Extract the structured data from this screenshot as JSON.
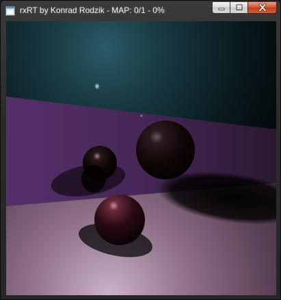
{
  "window": {
    "title": "rxRT by Konrad Rodzik - MAP: 0/1 - 0%",
    "icon": "app-window-icon",
    "controls": [
      "minimize-icon",
      "maximize-icon",
      "close-icon"
    ]
  },
  "colors": {
    "sky_glow": "#1f4a55",
    "wall": "#4a2a55",
    "floor": "#8a6a80",
    "sphere": "#2a0a12"
  }
}
